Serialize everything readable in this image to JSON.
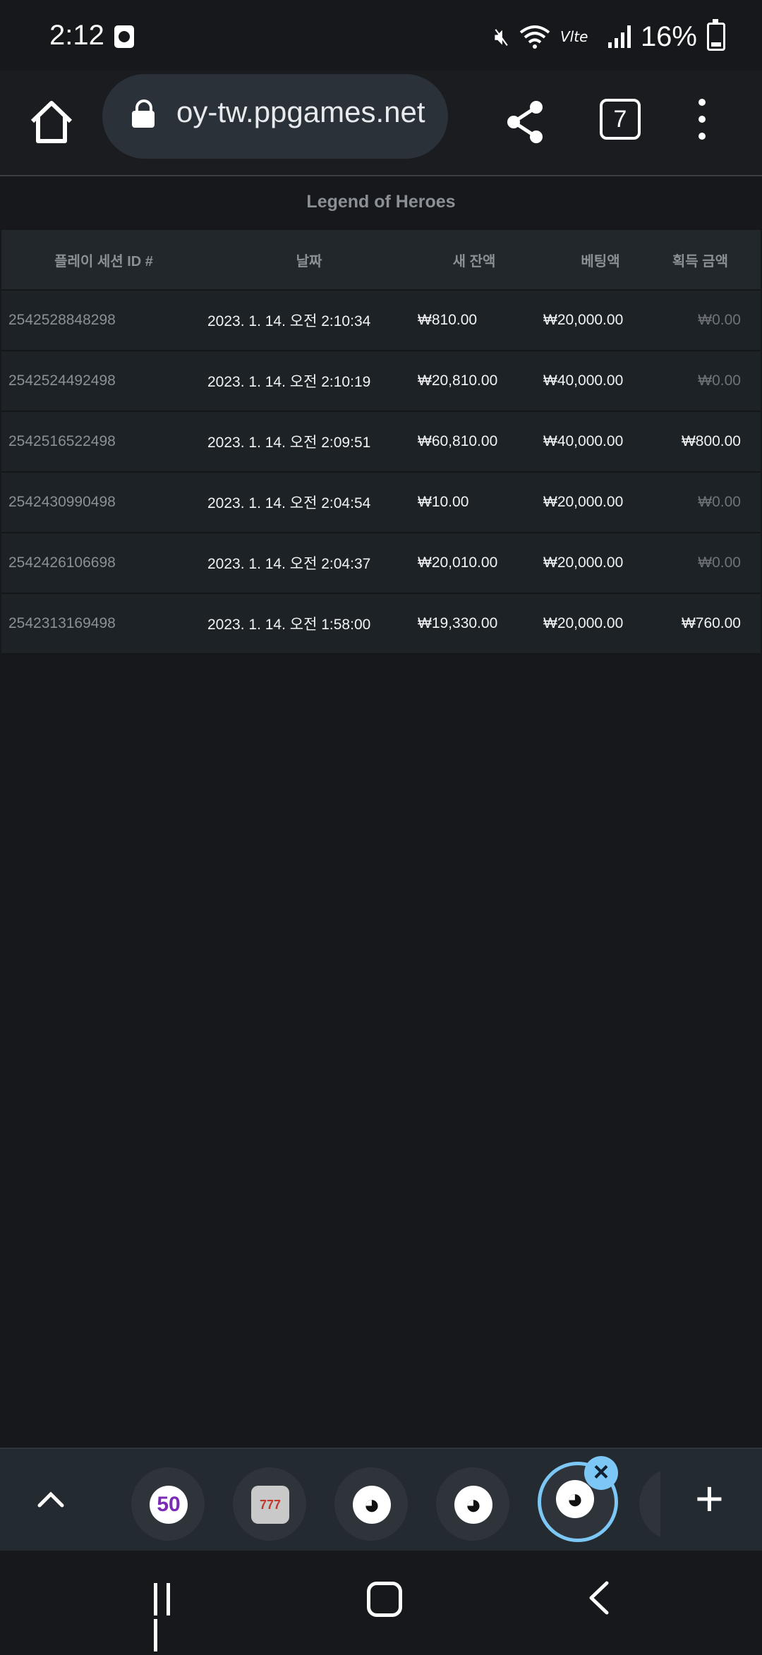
{
  "status_bar": {
    "time": "2:12",
    "battery": "16%"
  },
  "browser": {
    "url": "oy-tw.ppgames.net",
    "tab_count": "7"
  },
  "page": {
    "title": "Legend of Heroes",
    "columns": [
      "플레이 세션 ID #",
      "날짜",
      "새 잔액",
      "베팅액",
      "획득 금액"
    ],
    "rows": [
      {
        "id": "2542528848298",
        "date": "2023. 1. 14. 오전 2:10:34",
        "balance": "₩810.00",
        "bet": "₩20,000.00",
        "win": "₩0.00"
      },
      {
        "id": "2542524492498",
        "date": "2023. 1. 14. 오전 2:10:19",
        "balance": "₩20,810.00",
        "bet": "₩40,000.00",
        "win": "₩0.00"
      },
      {
        "id": "2542516522498",
        "date": "2023. 1. 14. 오전 2:09:51",
        "balance": "₩60,810.00",
        "bet": "₩40,000.00",
        "win": "₩800.00"
      },
      {
        "id": "2542430990498",
        "date": "2023. 1. 14. 오전 2:04:54",
        "balance": "₩10.00",
        "bet": "₩20,000.00",
        "win": "₩0.00"
      },
      {
        "id": "2542426106698",
        "date": "2023. 1. 14. 오전 2:04:37",
        "balance": "₩20,010.00",
        "bet": "₩20,000.00",
        "win": "₩0.00"
      },
      {
        "id": "2542313169498",
        "date": "2023. 1. 14. 오전 1:58:00",
        "balance": "₩19,330.00",
        "bet": "₩20,000.00",
        "win": "₩760.00"
      }
    ]
  },
  "tab_strip": {
    "tabs": [
      {
        "icon": "badge-50-icon",
        "label": "50"
      },
      {
        "icon": "slot-machine-icon",
        "label": "777"
      },
      {
        "icon": "globe-icon",
        "label": ""
      },
      {
        "icon": "globe-icon",
        "label": ""
      },
      {
        "icon": "globe-icon",
        "label": "",
        "active": true
      }
    ]
  },
  "colors": {
    "background": "#16181c",
    "active_tab_ring": "#7cc7f5"
  }
}
